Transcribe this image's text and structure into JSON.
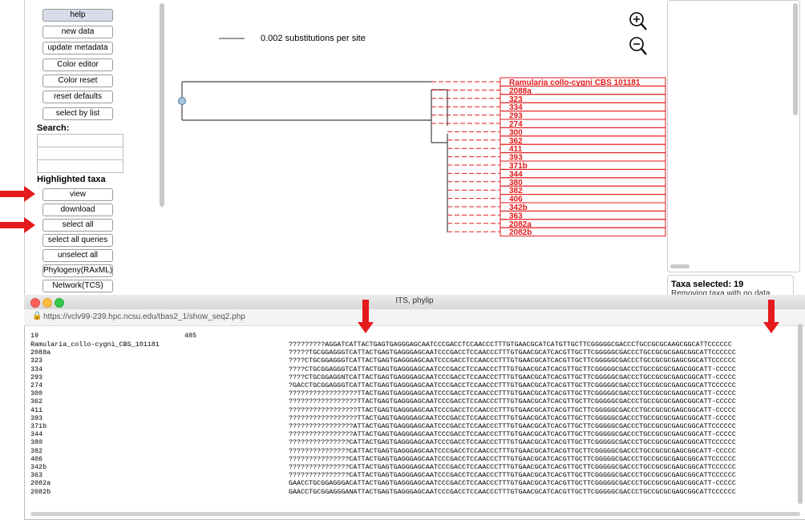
{
  "sidebar": {
    "buttons": {
      "help": "help",
      "new_data": "new data",
      "update_metadata": "update metadata",
      "color_editor": "Color editor",
      "color_reset": "Color reset",
      "reset_defaults": "reset defaults",
      "select_by_list": "select by list",
      "view": "view",
      "download": "download",
      "select_all": "select all",
      "select_all_queries": "select all queries",
      "unselect_all": "unselect all",
      "phylogeny": "Phylogeny(RAxML)",
      "network": "Network(TCS)"
    },
    "search_label": "Search:",
    "highlighted_label": "Highlighted taxa"
  },
  "tree": {
    "scale_label": "0.002 substitutions per site",
    "taxa": [
      "Ramularia collo-cygni CBS 101181",
      "2088a",
      "323",
      "334",
      "293",
      "274",
      "300",
      "362",
      "411",
      "393",
      "371b",
      "344",
      "380",
      "382",
      "406",
      "342b",
      "363",
      "2082a",
      "2082b"
    ],
    "highlight_color": "#e41a1c"
  },
  "right_panel": {
    "taxa_selected": "Taxa selected: 19",
    "status_text": "Removing taxa with no data"
  },
  "popup": {
    "title": "ITS, phylip",
    "url": "https://vclv99-239.hpc.ncsu.edu/tbas2_1/show_seq2.php",
    "header_count": "19",
    "header_length": "485",
    "rows": [
      {
        "name": "Ramularia_collo-cygni_CBS_101181",
        "seq": "?????????AGGATCATTACTGAGTGAGGGAGCAATCCCGACCTCCAACCCTTTGTGAACGCATCATGTTGCTTCGGGGGCGACCCTGCCGCGCAAGCGGCATTCCCCCC"
      },
      {
        "name": "2088a",
        "seq": "?????TGCGGAGGGTCATTACTGAGTGAGGGAGCAATCCCGACCTCCAACCCTTTGTGAACGCATCACGTTGCTTCGGGGGCGACCCTGCCGCGCGAGCGGCATTCCCCCC"
      },
      {
        "name": "323",
        "seq": "????CTGCGGAGGGTCATTACTGAGTGAGGGAGCAATCCCGACCTCCAACCCTTTGTGAACGCATCACGTTGCTTCGGGGGCGACCCTGCCGCGCGAGCGGCATTCCCCCC"
      },
      {
        "name": "334",
        "seq": "????CTGCGGAGGGTCATTACTGAGTGAGGGAGCAATCCCGACCTCCAACCCTTTGTGAACGCATCACGTTGCTTCGGGGGCGACCCTGCCGCGCGAGCGGCATT-CCCCC"
      },
      {
        "name": "293",
        "seq": "????CTGCGGAGGNTCATTACTGAGTGAGGGAGCAATCCCGACCTCCAACCCTTTGTGAACGCATCACGTTGCTTCGGGGGCGACCCTGCCGCGCGAGCGGCATT-CCCCC"
      },
      {
        "name": "274",
        "seq": "?GACCTGCGGAGGGTCATTACTGAGTGAGGGAGCAATCCCGACCTCCAACCCTTTGTGAACGCATCACGTTGCTTCGGGGGCGACCCTGCCGCGCGAGCGGCATTCCCCCC"
      },
      {
        "name": "300",
        "seq": "?????????????????TTACTGAGTGAGGGAGCAATCCCGACCTCCAACCCTTTGTGAACGCATCACGTTGCTTCGGGGGCGACCCTGCCGCGCGAGCGGCATT-CCCCC"
      },
      {
        "name": "362",
        "seq": "?????????????????TTACTGAGTGAGGGAGCAATCCCGACCTCCAACCCTTTGTGAACGCATCACGTTGCTTCGGGGGCGACCCTGCCGCGCGAGCGGCATT-CCCCC"
      },
      {
        "name": "411",
        "seq": "?????????????????TTACTGAGTGAGGGAGCAATCCCGACCTCCAACCCTTTGTGAACGCATCACGTTGCTTCGGGGGCGACCCTGCCGCGCGAGCGGCATT-CCCCC"
      },
      {
        "name": "393",
        "seq": "?????????????????TTACTGAGTGAGGGAGCAATCCCGACCTCCAACCCTTTGTGAACGCATCACGTTGCTTCGGGGGCGACCCTGCCGCGCGAGCGGCATT-CCCCC"
      },
      {
        "name": "371b",
        "seq": "????????????????ATTACTGAGTGAGGGAGCAATCCCGACCTCCAACCCTTTGTGAACGCATCACGTTGCTTCGGGGGCGACCCTGCCGCGCGAGCGGCATTCCCCCC"
      },
      {
        "name": "344",
        "seq": "????????????????ATTACTGAGTGAGGGAGCAATCCCGACCTCCAACCCTTTGTGAACGCATCACGTTGCTTCGGGGGCGACCCTGCCGCGCGAGCGGCATT-CCCCC"
      },
      {
        "name": "380",
        "seq": "???????????????CATTACTGAGTGAGGGAGCAATCCCGACCTCCAACCCTTTGTGAACGCATCACGTTGCTTCGGGGGCGACCCTGCCGCGCGAGCGGCATTCCCCCC"
      },
      {
        "name": "382",
        "seq": "???????????????CATTACTGAGTGAGGGAGCAATCCCGACCTCCAACCCTTTGTGAACGCATCACGTTGCTTCGGGGGCGACCCTGCCGCGCGAGCGGCATT-CCCCC"
      },
      {
        "name": "406",
        "seq": "???????????????CATTACTGAGTGAGGGAGCAATCCCGACCTCCAACCCTTTGTGAACGCATCACGTTGCTTCGGGGGCGACCCTGCCGCGCGAGCGGCATTCCCCCC"
      },
      {
        "name": "342b",
        "seq": "???????????????CATTACTGAGTGAGGGAGCAATCCCGACCTCCAACCCTTTGTGAACGCATCACGTTGCTTCGGGGGCGACCCTGCCGCGCGAGCGGCATTCCCCCC"
      },
      {
        "name": "363",
        "seq": "???????????????CATTACTGAGTGAGGGAGCAATCCCGACCTCCAACCCTTTGTGAACGCATCACGTTGCTTCGGGGGCGACCCTGCCGCGCGAGCGGCATTCCCCCC"
      },
      {
        "name": "2082a",
        "seq": "GAACCTGCGGAGGGACATTACTGAGTGAGGGAGCAATCCCGACCTCCAACCCTTTGTGAACGCATCACGTTGCTTCGGGGGCGACCCTGCCGCGCGAGCGGCATT-CCCCC"
      },
      {
        "name": "2082b",
        "seq": "GAACCTGCGGAGGGANATTACTGAGTGAGGGAGCAATCCCGACCTCCAACCCTTTGTGAACGCATCACGTTGCTTCGGGGGCGACCCTGCCGCGCGAGCGGCATTCCCCCC"
      }
    ]
  }
}
